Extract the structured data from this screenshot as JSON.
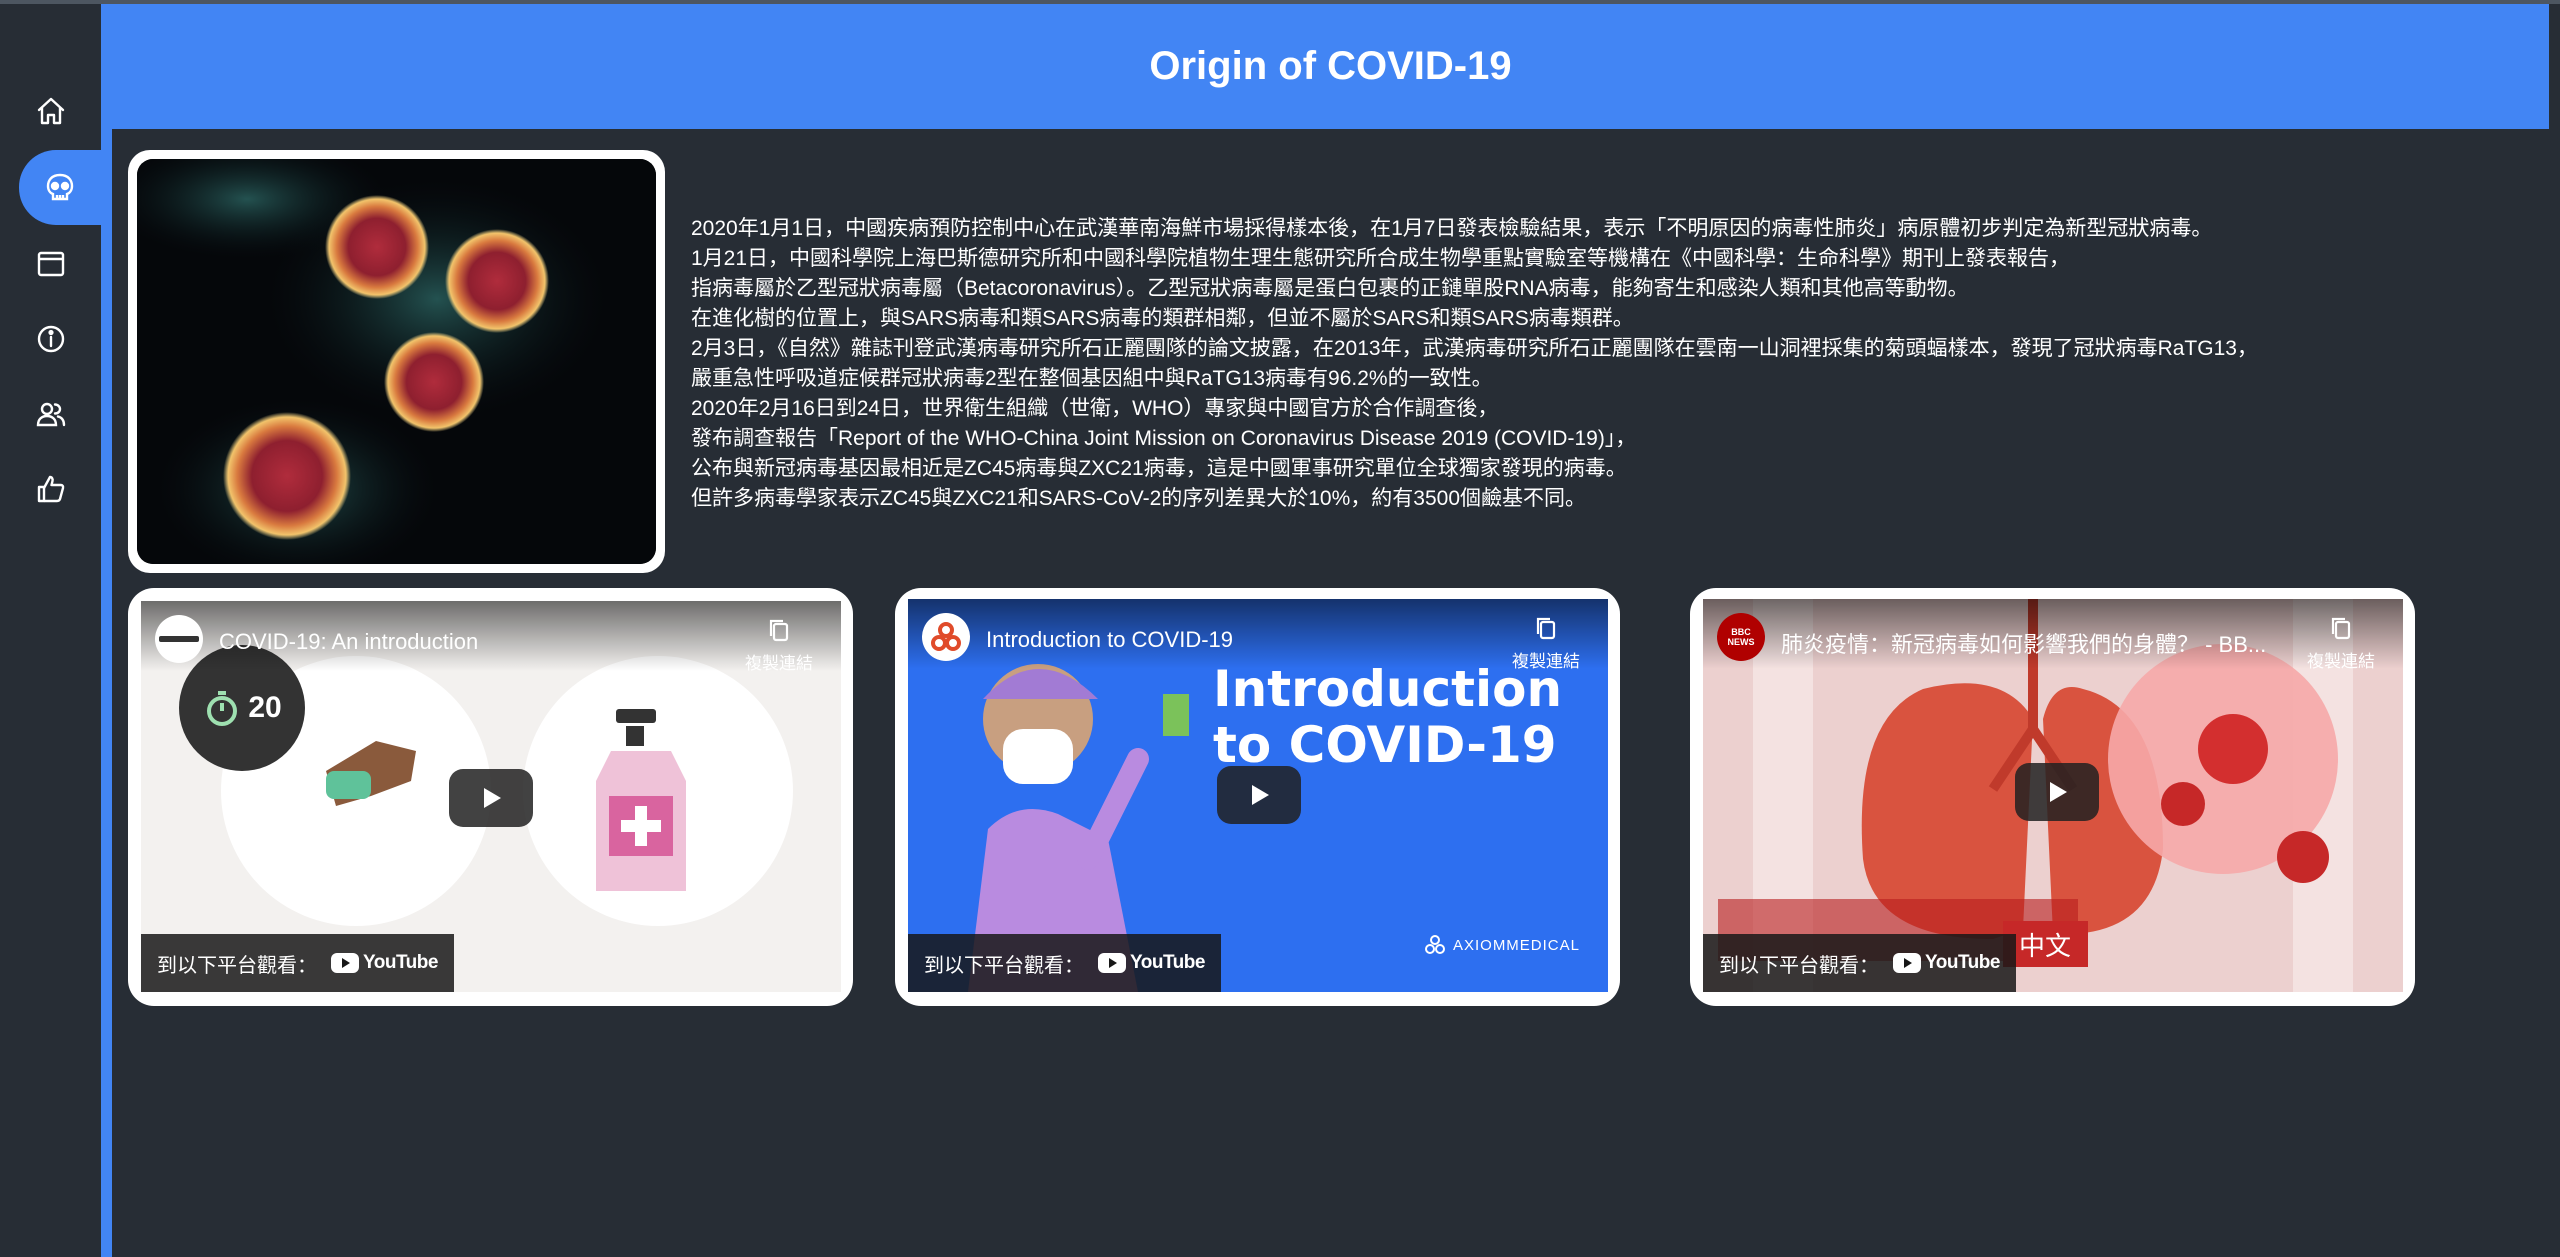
{
  "header": {
    "title": "Origin of COVID-19"
  },
  "sidebar": {
    "items": [
      {
        "icon": "home-icon",
        "active": false
      },
      {
        "icon": "virus-skull-icon",
        "active": true
      },
      {
        "icon": "window-icon",
        "active": false
      },
      {
        "icon": "info-icon",
        "active": false
      },
      {
        "icon": "users-icon",
        "active": false
      },
      {
        "icon": "thumbs-up-icon",
        "active": false
      }
    ]
  },
  "article": {
    "lines": [
      "2020年1月1日，中國疾病預防控制中心在武漢華南海鮮市場採得樣本後，在1月7日發表檢驗結果，表示「不明原因的病毒性肺炎」病原體初步判定為新型冠狀病毒。",
      "1月21日，中國科學院上海巴斯德研究所和中國科學院植物生理生態研究所合成生物學重點實驗室等機構在《中國科學：生命科學》期刊上發表報告，",
      "指病毒屬於乙型冠狀病毒屬（Betacoronavirus）。乙型冠狀病毒屬是蛋白包裹的正鏈單股RNA病毒，能夠寄生和感染人類和其他高等動物。",
      "在進化樹的位置上，與SARS病毒和類SARS病毒的類群相鄰，但並不屬於SARS和類SARS病毒類群。",
      "2月3日，《自然》雜誌刊登武漢病毒研究所石正麗團隊的論文披露，在2013年，武漢病毒研究所石正麗團隊在雲南一山洞裡採集的菊頭蝠樣本，發現了冠狀病毒RaTG13，",
      "嚴重急性呼吸道症候群冠狀病毒2型在整個基因組中與RaTG13病毒有96.2%的一致性。",
      "2020年2月16日到24日，世界衛生組織（世衛，WHO）專家與中國官方於合作調查後，",
      "發布調查報告「Report of the WHO-China Joint Mission on Coronavirus Disease 2019 (COVID-19)」，",
      "公布與新冠病毒基因最相近是ZC45病毒與ZXC21病毒，這是中國軍事研究單位全球獨家發現的病毒。",
      "但許多病毒學家表示ZC45與ZXC21和SARS-CoV-2的序列差異大於10%，約有3500個鹼基不同。"
    ]
  },
  "videos": [
    {
      "title": "COVID-19: An introduction",
      "copy_label": "複製連結",
      "watch_on_label": "到以下平台觀看：",
      "platform": "YouTube",
      "timer_text": "20"
    },
    {
      "title": "Introduction to COVID-19",
      "copy_label": "複製連結",
      "watch_on_label": "到以下平台觀看：",
      "platform": "YouTube",
      "thumb_heading_1": "Introduction",
      "thumb_heading_2": "to COVID-19",
      "brand": "AXIOMMEDICAL"
    },
    {
      "title": "肺炎疫情：新冠病毒如何影響我們的身體？ - BB...",
      "copy_label": "複製連結",
      "watch_on_label": "到以下平台觀看：",
      "platform": "YouTube",
      "channel": "BBC NEWS",
      "lang_badge": "中文"
    }
  ],
  "colors": {
    "accent": "#4285f4",
    "background": "#272d35",
    "card": "#ffffff"
  }
}
